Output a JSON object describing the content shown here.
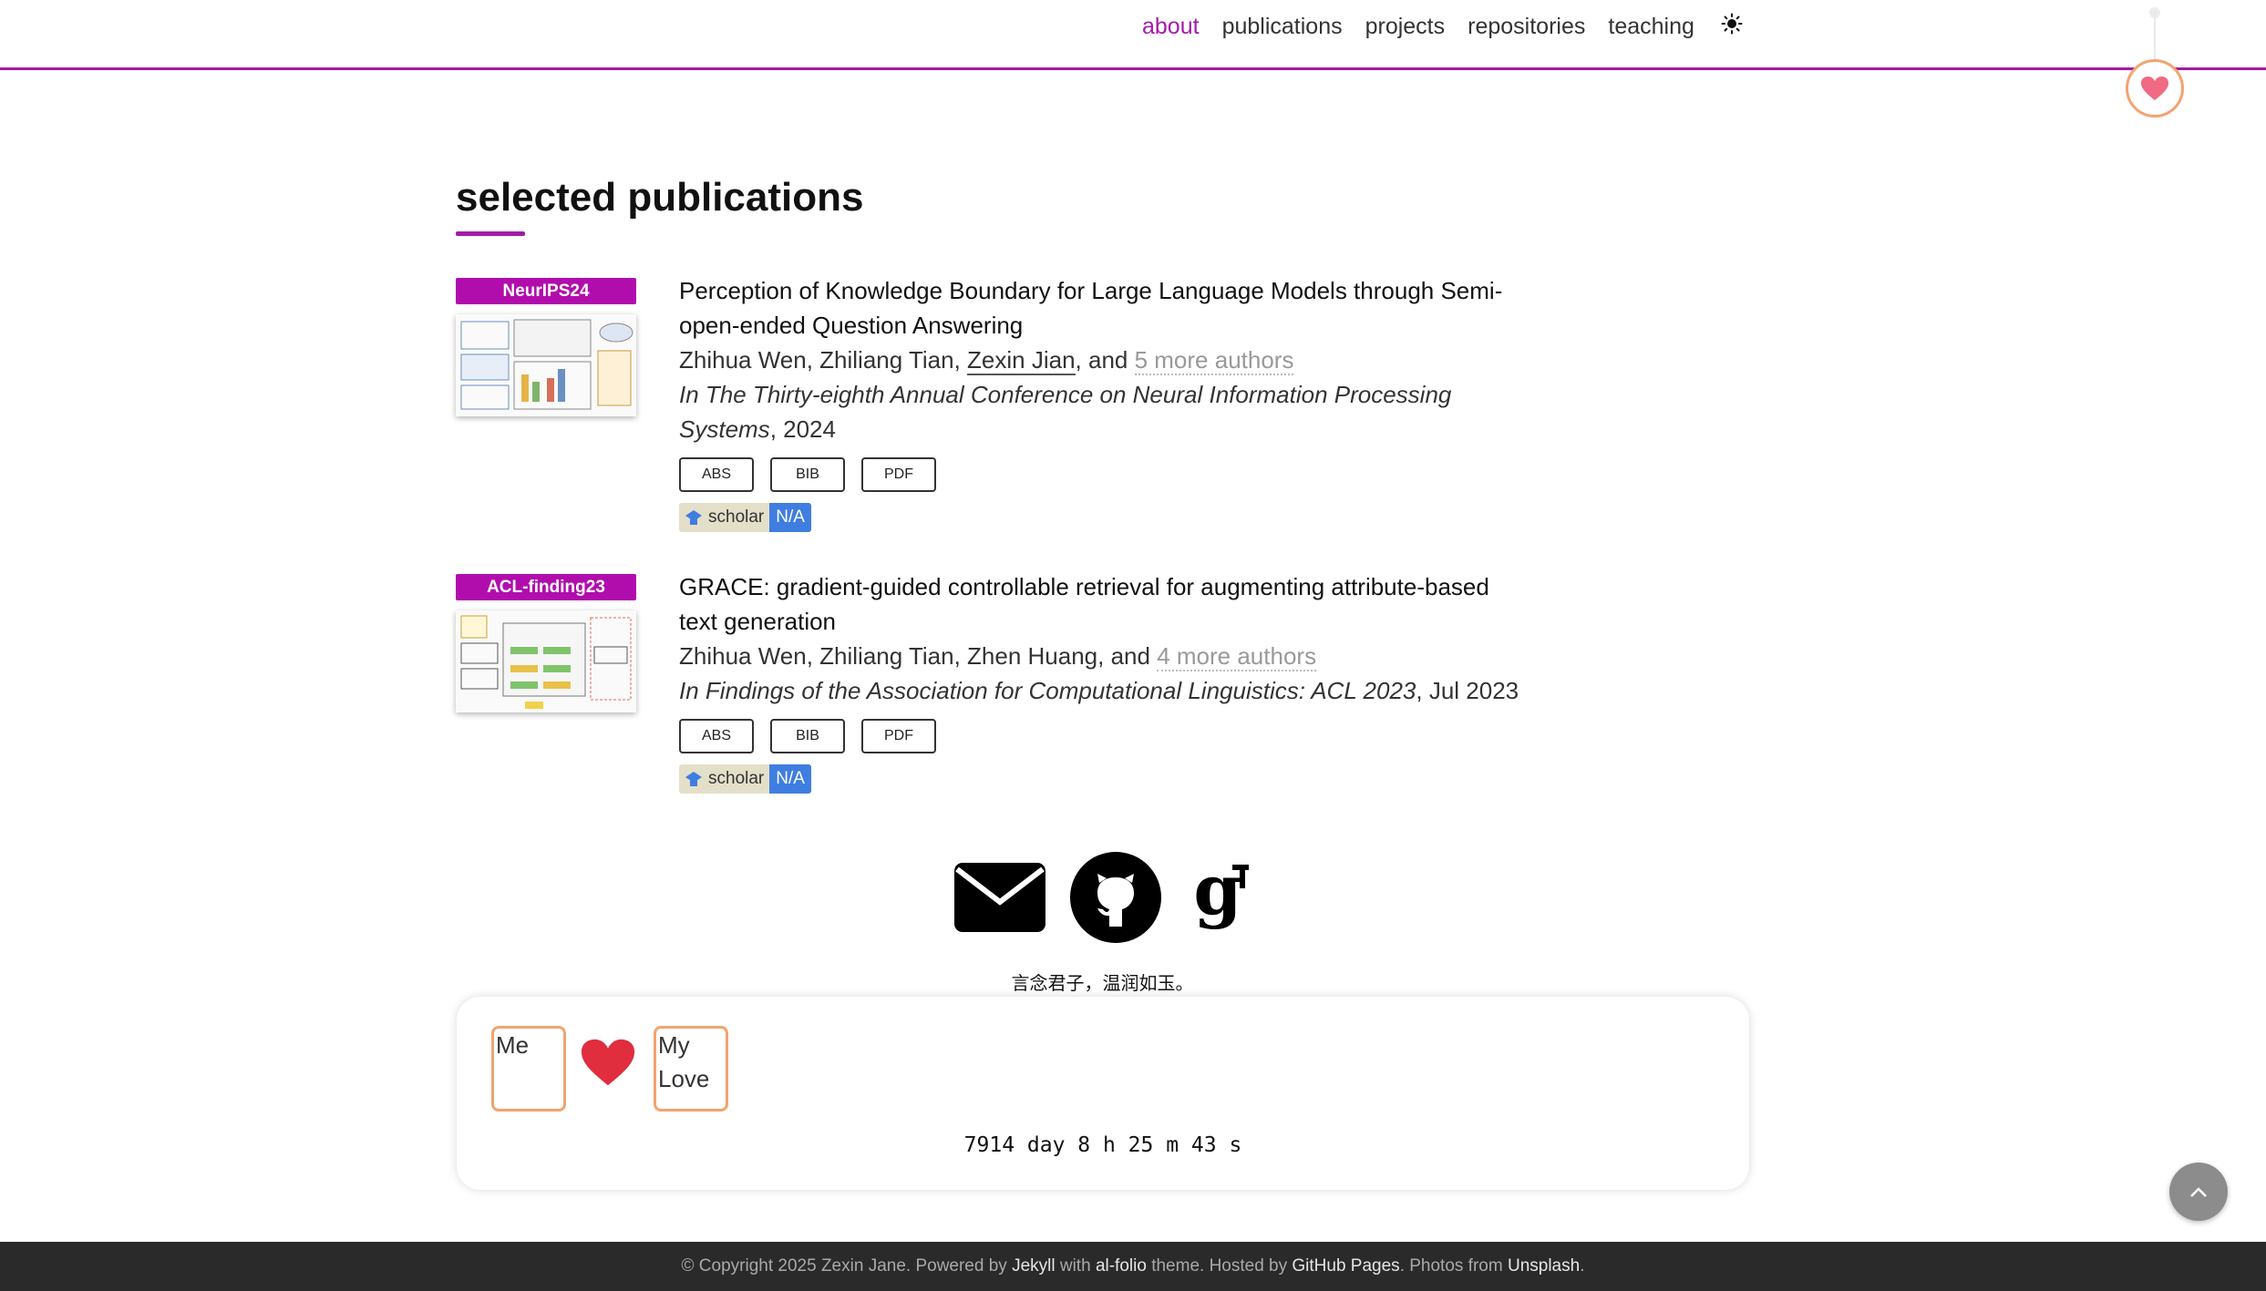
{
  "nav": {
    "items": [
      {
        "label": "about",
        "active": true
      },
      {
        "label": "publications",
        "active": false
      },
      {
        "label": "projects",
        "active": false
      },
      {
        "label": "repositories",
        "active": false
      },
      {
        "label": "teaching",
        "active": false
      }
    ],
    "theme_icon": "sun-icon",
    "accent_color": "#a31ba8"
  },
  "section": {
    "title": "selected publications"
  },
  "publications": [
    {
      "badge": "NeurIPS24",
      "title": "Perception of Knowledge Boundary for Large Language Models through Semi-open-ended Question Answering",
      "authors_plain": "Zhihua Wen, Zhiliang Tian, ",
      "author_me": "Zexin Jian",
      "authors_and": ", and ",
      "more_authors": "5 more authors",
      "venue_italic": "In The Thirty-eighth Annual Conference on Neural Information Processing Systems",
      "venue_suffix": ", 2024",
      "buttons": [
        "ABS",
        "BIB",
        "PDF"
      ],
      "scholar_label": "scholar",
      "scholar_value": "N/A"
    },
    {
      "badge": "ACL-finding23",
      "title": "GRACE: gradient-guided controllable retrieval for augmenting attribute-based text generation",
      "authors_plain": "Zhihua Wen, Zhiliang Tian, Zhen Huang",
      "authors_and": ", and ",
      "more_authors": "4 more authors",
      "venue_italic": "In Findings of the Association for Computational Linguistics: ACL 2023",
      "venue_suffix": ", Jul 2023",
      "buttons": [
        "ABS",
        "BIB",
        "PDF"
      ],
      "scholar_label": "scholar",
      "scholar_value": "N/A"
    }
  ],
  "social": {
    "icons": [
      "email-icon",
      "github-icon",
      "google-scholar-icon"
    ]
  },
  "motto": "言念君子，温润如玉。",
  "love": {
    "left_label": "Me",
    "right_label": "My Love",
    "timer": "7914 day 8 h 25 m 43 s"
  },
  "footer": {
    "prefix": "© Copyright 2025 Zexin Jane. Powered by ",
    "jekyll": "Jekyll",
    "mid1": " with ",
    "theme": "al-folio",
    "mid2": " theme. Hosted by ",
    "host": "GitHub Pages",
    "mid3": ". Photos from ",
    "photos": "Unsplash",
    "end": "."
  }
}
